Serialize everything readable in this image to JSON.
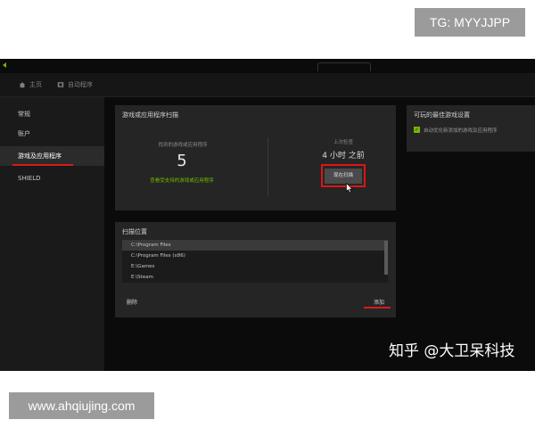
{
  "overlay": {
    "tg_label": "TG: MYYJJPP",
    "url_label": "www.ahqiujing.com",
    "watermark": "知乎 @大卫呆科技"
  },
  "nav": {
    "home_label": "主页",
    "autostart_label": "自动程序"
  },
  "sidebar": {
    "items": [
      {
        "label": "常规"
      },
      {
        "label": "账户"
      },
      {
        "label": "游戏及应用程序"
      },
      {
        "label": "SHIELD"
      }
    ],
    "active_index": 2
  },
  "scan_panel": {
    "title": "游戏或应用程序扫描",
    "found_label": "找到的游戏或应用程序",
    "found_count": "5",
    "found_link": "查看受支持的游戏或应用程序",
    "last_scan_label": "上次检查",
    "last_scan_value": "4 小时 之前",
    "scan_button": "现在扫描"
  },
  "scan_location_panel": {
    "title": "扫描位置",
    "locations": [
      "C:\\Program Files",
      "C:\\Program Files (x86)",
      "E:\\Games",
      "E:\\Steam"
    ],
    "selected_index": 0,
    "delete_button": "删除",
    "add_button": "添加"
  },
  "settings_panel": {
    "title": "可玩的最佳游戏设置",
    "option_label": "自动优化新添加的游戏及应用程序",
    "option_checked": true
  },
  "colors": {
    "accent_green": "#76b900",
    "highlight_red": "#e01414"
  },
  "icons": {
    "home": "home-icon",
    "autostart": "film-icon",
    "back": "back-arrow-icon",
    "cursor": "mouse-cursor-icon",
    "check": "checkmark-icon"
  }
}
